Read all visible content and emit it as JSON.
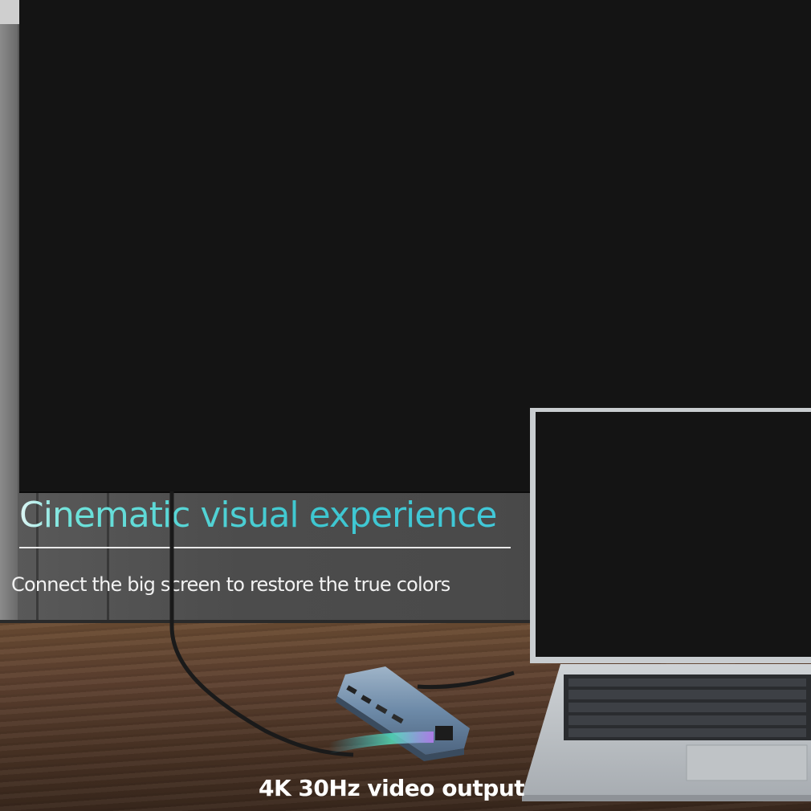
{
  "headline": "Cinematic visual experience",
  "subheadline": "Connect the big screen to restore the true colors",
  "caption": "4K 30Hz video output",
  "colors": {
    "headline_accent": "#41c8d8",
    "tv_screen": "#141414",
    "desk_wood": "#5e4130",
    "hub_body": "#6d8aa8"
  }
}
